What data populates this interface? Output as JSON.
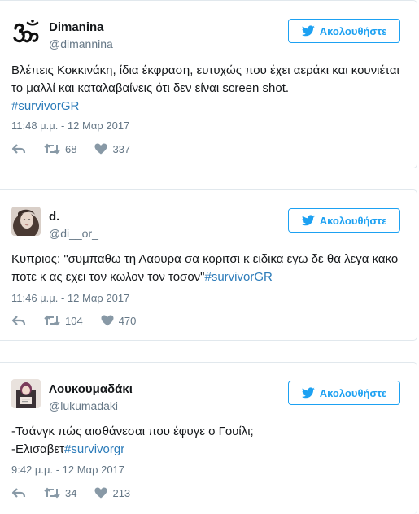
{
  "tweets": [
    {
      "name": "Dimanina",
      "handle": "@dimannina",
      "follow_label": "Ακολουθήστε",
      "text": "Βλέπεις Κοκκινάκη, ίδια έκφραση, ευτυχώς που έχει αεράκι και κουνιέται το μαλλί και καταλαβαίνεις ότι δεν είναι screen shot.",
      "hashtag": "#survivorGR",
      "timestamp": "11:48 μ.μ. - 12 Μαρ 2017",
      "retweets": "68",
      "likes": "337"
    },
    {
      "name": "d.",
      "handle": "@di__or_",
      "follow_label": "Ακολουθήστε",
      "text": "Κυπριος: \"συμπαθω τη Λαουρα σα κοριτσι κ ειδικα εγω δε θα λεγα κακο ποτε κ ας εχει τον κωλον τον τοσον\"",
      "hashtag": "#survivorGR",
      "timestamp": "11:46 μ.μ. - 12 Μαρ 2017",
      "retweets": "104",
      "likes": "470"
    },
    {
      "name": "Λουκουμαδάκι",
      "handle": "@lukumadaki",
      "follow_label": "Ακολουθήστε",
      "text_line1": "-Τσάνγκ πώς αισθάνεσαι που έφυγε ο Γουίλι;",
      "text_line2": "-Ελισαβετ",
      "hashtag": "#survivorgr",
      "timestamp": "9:42 μ.μ. - 12 Μαρ 2017",
      "retweets": "34",
      "likes": "213"
    }
  ],
  "colors": {
    "accent": "#1da1f2",
    "link": "#2b7bb9",
    "muted": "#657786",
    "border": "#e1e8ed"
  },
  "icons": [
    "om-symbol-avatar",
    "twitter-bird-icon",
    "reply-icon",
    "retweet-icon",
    "heart-icon"
  ]
}
